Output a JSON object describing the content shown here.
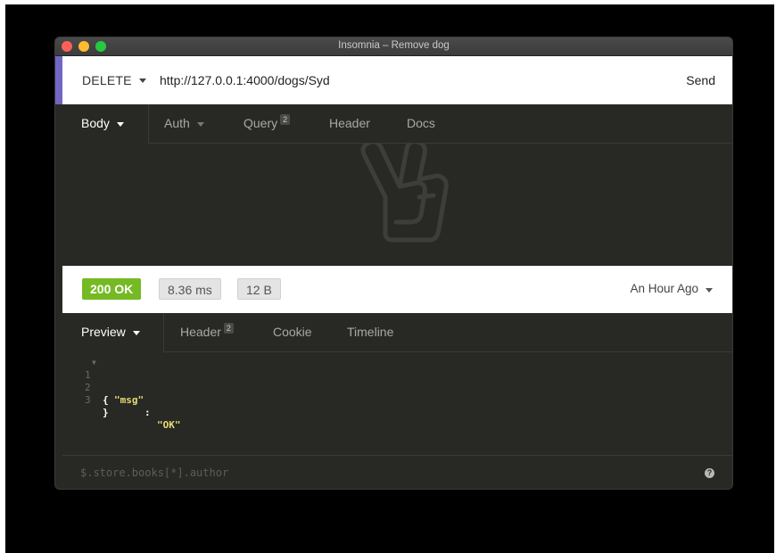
{
  "window": {
    "title": "Insomnia – Remove dog"
  },
  "request": {
    "method": "DELETE",
    "url": "http://127.0.0.1:4000/dogs/Syd",
    "send_label": "Send",
    "tabs": [
      {
        "label": "Body",
        "active": true
      },
      {
        "label": "Auth",
        "active": false
      },
      {
        "label": "Query",
        "badge": "2",
        "active": false
      },
      {
        "label": "Header",
        "active": false
      },
      {
        "label": "Docs",
        "active": false
      }
    ],
    "empty_state_icon": "peace-hand-icon"
  },
  "response": {
    "status": "200 OK",
    "time": "8.36 ms",
    "size": "12 B",
    "time_ago": "An Hour Ago",
    "tabs": [
      {
        "label": "Preview",
        "active": true
      },
      {
        "label": "Header",
        "badge": "2",
        "active": false
      },
      {
        "label": "Cookie",
        "active": false
      },
      {
        "label": "Timeline",
        "active": false
      }
    ],
    "body_lines": [
      {
        "num": "1",
        "text": "{"
      },
      {
        "num": "2",
        "key": "\"msg\"",
        "sep": ": ",
        "value": "\"OK\""
      },
      {
        "num": "3",
        "text": "}"
      }
    ],
    "filter_placeholder": "$.store.books[*].author",
    "help_icon": "question-circle-icon",
    "help_glyph": "?"
  },
  "colors": {
    "accent": "#7166c2",
    "status_ok": "#75ba24",
    "dark_bg": "#282925",
    "json_string": "#e6db74"
  }
}
